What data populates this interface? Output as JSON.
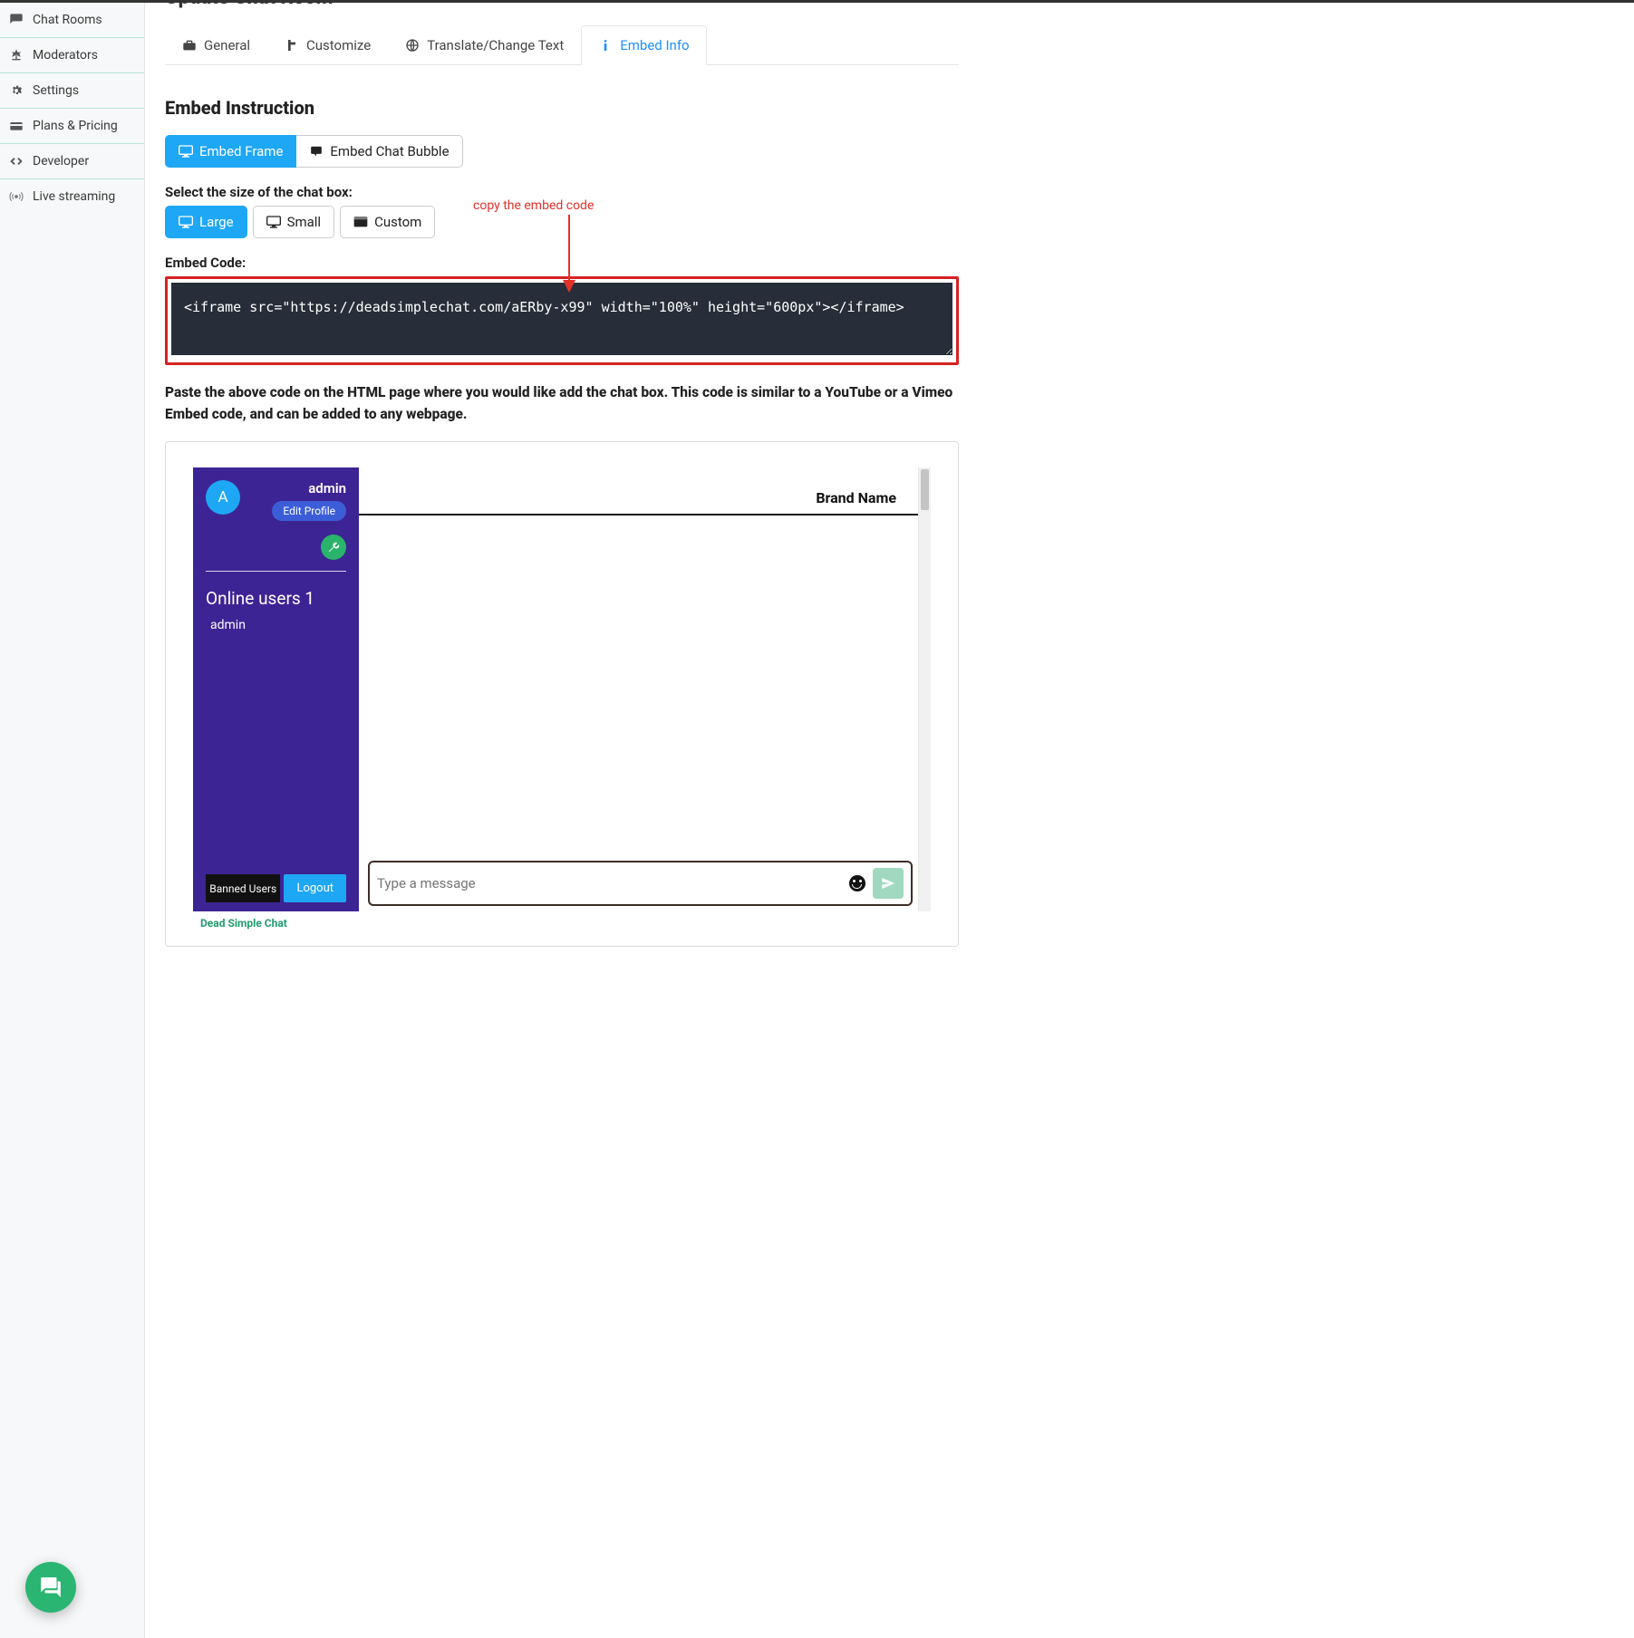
{
  "sidebar": {
    "items": [
      {
        "label": "Chat Rooms"
      },
      {
        "label": "Moderators"
      },
      {
        "label": "Settings"
      },
      {
        "label": "Plans & Pricing"
      },
      {
        "label": "Developer"
      },
      {
        "label": "Live streaming"
      }
    ]
  },
  "page": {
    "title_cut": "Update Chat Room"
  },
  "tabs": {
    "items": [
      {
        "label": "General"
      },
      {
        "label": "Customize"
      },
      {
        "label": "Translate/Change Text"
      },
      {
        "label": "Embed Info"
      }
    ]
  },
  "embed": {
    "heading": "Embed Instruction",
    "mode_frame": "Embed Frame",
    "mode_bubble": "Embed Chat Bubble",
    "size_label": "Select the size of the chat box:",
    "size_large": "Large",
    "size_small": "Small",
    "size_custom": "Custom",
    "code_label": "Embed Code:",
    "code_value": "<iframe src=\"https://deadsimplechat.com/aERby-x99\" width=\"100%\" height=\"600px\"></iframe>",
    "annot": "copy the embed code",
    "paste_text": "Paste the above code on the HTML page where you would like add the chat box. This code is similar to a YouTube or a Vimeo Embed code, and can be added to any webpage."
  },
  "chat": {
    "avatar_letter": "A",
    "username": "admin",
    "edit_profile": "Edit Profile",
    "online_title": "Online users 1",
    "online_user": "admin",
    "banned_btn": "Banned Users",
    "logout_btn": "Logout",
    "brand": "Brand Name",
    "input_placeholder": "Type a message",
    "footer": "Dead Simple Chat"
  }
}
